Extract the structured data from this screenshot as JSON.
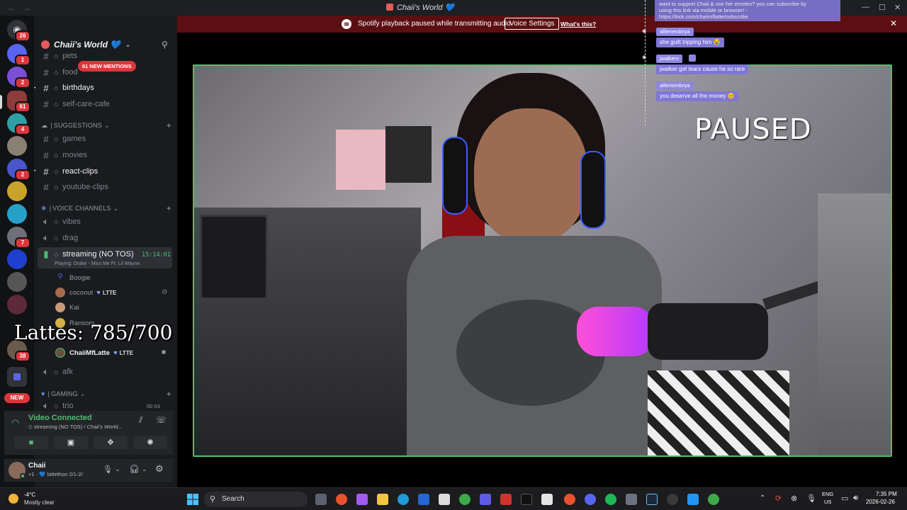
{
  "window": {
    "title": "Chaii's World 💙",
    "title_prefix_icon": "server-icon"
  },
  "notice": {
    "text": "Spotify playback paused while transmitting audio.",
    "button": "Voice Settings",
    "link": "What's this?"
  },
  "rail": {
    "badges": [
      "26",
      "1",
      "2",
      "61",
      "4",
      "2",
      "7",
      "38"
    ],
    "new_label": "NEW"
  },
  "guild": {
    "name": "Chaii's World 💙"
  },
  "channels": {
    "pets": "pets",
    "food": "food",
    "mentions": "61 NEW MENTIONS",
    "birthdays": "birthdays",
    "self_care": "self-care-cafe",
    "cat_suggestions": "SUGGESTIONS",
    "games": "games",
    "movies": "movies",
    "react_clips": "react-clips",
    "youtube_clips": "youtube-clips",
    "cat_voice": "VOICE CHANNELS",
    "vibes": "vibes",
    "drag": "drag",
    "streaming": "streaming (NO TOS)",
    "streaming_time": "15:14:01",
    "playing": "Playing: Drake - Miss Me Ft. Lil Wayne",
    "afk": "afk",
    "cat_gaming": "GAMING",
    "trio": "trio",
    "trio_count": "00  03"
  },
  "voice_users": [
    {
      "name": "Boogie",
      "tag": ""
    },
    {
      "name": "coconut",
      "tag": "LTTE"
    },
    {
      "name": "Kai",
      "tag": ""
    },
    {
      "name": "Ransom",
      "tag": ""
    },
    {
      "name": "ChaiiMfLatte",
      "tag": "LTTE"
    }
  ],
  "overlay": {
    "lattes": "Lattes: 785/700",
    "paused": "PAUSED"
  },
  "voice_panel": {
    "status": "Video Connected",
    "sub_channel": "streaming (NO TOS) / ",
    "sub_server": "Chaii's World..."
  },
  "user_panel": {
    "name": "Chaii",
    "status": "+1 · 💙 lattethon 2/1-2/"
  },
  "chat": {
    "top_text_1": "want to support Chaii & use her emotes? you can subscribe by",
    "top_text_2": "using this link via mobile or browser! -",
    "top_link": "https://kick.com/chaiimflatte/subscribe",
    "messages": [
      {
        "user": "allienembrya",
        "text": "she guilt tripping him 😭"
      },
      {
        "user": "jwalkerv",
        "text": "jwalker get tears cause he so rare"
      },
      {
        "user": "allienembrya",
        "text": "you deserve all the money 🥺"
      }
    ]
  },
  "taskbar": {
    "weather_temp": "-4°C",
    "weather_desc": "Mostly clear",
    "search": "Search",
    "lang_1": "ENG",
    "lang_2": "US",
    "time": "7:35 PM",
    "date": "2026-02-26"
  },
  "colors": {
    "accent_green": "#4dbf72",
    "notice_bg": "#5b0f12",
    "mention_red": "#da373c",
    "chat_purple": "#8d86e0"
  }
}
